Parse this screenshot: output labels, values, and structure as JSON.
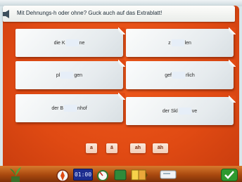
{
  "instruction": "Mit Dehnungs-h oder ohne? Guck auch auf das Extrablatt!",
  "cards": [
    {
      "before": "die K",
      "after": "ne"
    },
    {
      "before": "z",
      "after": "len"
    },
    {
      "before": "pl",
      "after": "gen"
    },
    {
      "before": "gef",
      "after": "rlich"
    },
    {
      "before": "der B",
      "after": "nhof"
    },
    {
      "before": "der Skl",
      "after": "ve"
    }
  ],
  "choices": [
    "a",
    "ä",
    "ah",
    "äh"
  ],
  "toolbar": {
    "clock": "01:00"
  },
  "colors": {
    "board": "#e04a13",
    "gap": "#e6eef8",
    "ok": "#2f9a2f"
  }
}
